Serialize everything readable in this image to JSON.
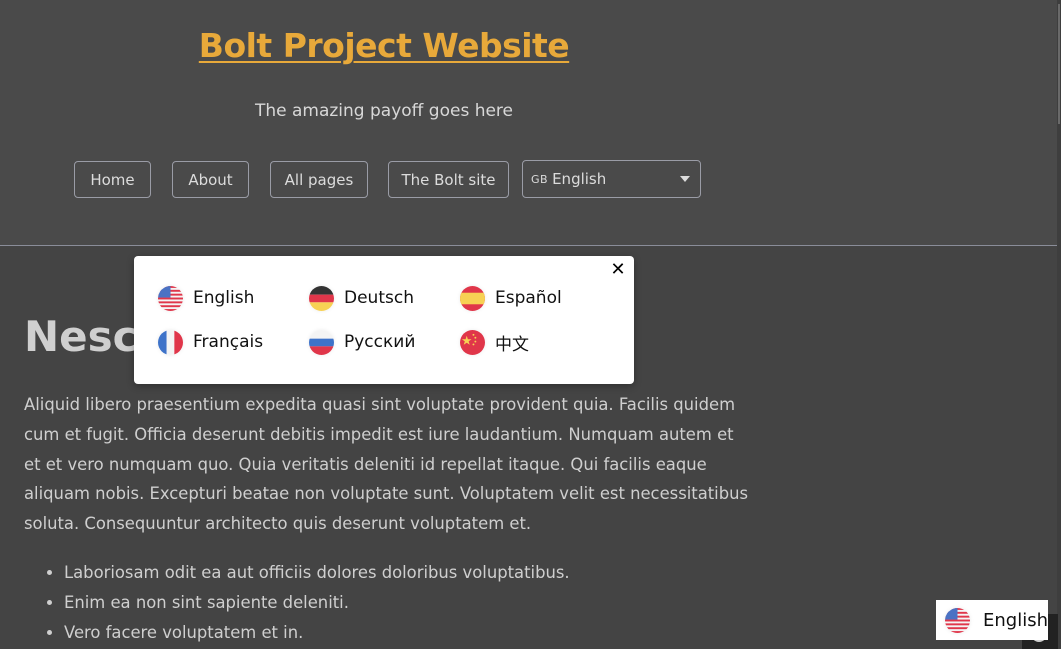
{
  "header": {
    "site_title": "Bolt Project Website",
    "payoff": "The amazing payoff goes here",
    "nav": [
      {
        "label": "Home"
      },
      {
        "label": "About"
      },
      {
        "label": "All pages"
      },
      {
        "label": "The Bolt site"
      }
    ],
    "language_select": {
      "flag_code": "GB",
      "selected": "English"
    }
  },
  "content": {
    "heading": "Nescii",
    "paragraph": "Aliquid libero praesentium expedita quasi sint voluptate provident quia. Facilis quidem cum et fugit. Officia deserunt debitis impedit est iure laudantium. Numquam autem et et et vero numquam quo. Quia veritatis deleniti id repellat itaque. Qui facilis eaque aliquam nobis. Excepturi beatae non voluptate sunt. Voluptatem velit est necessitatibus soluta. Consequuntur architecto quis deserunt voluptatem et.",
    "list": [
      "Laboriosam odit ea aut officiis dolores doloribus voluptatibus.",
      "Enim ea non sint sapiente deleniti.",
      "Vero facere voluptatem et in."
    ]
  },
  "language_modal": {
    "close_icon": "close-icon",
    "options": [
      {
        "label": "English",
        "flag": "us-flag-icon"
      },
      {
        "label": "Deutsch",
        "flag": "de-flag-icon"
      },
      {
        "label": "Español",
        "flag": "es-flag-icon"
      },
      {
        "label": "Français",
        "flag": "fr-flag-icon"
      },
      {
        "label": "Русский",
        "flag": "ru-flag-icon"
      },
      {
        "label": "中文",
        "flag": "cn-flag-icon"
      }
    ]
  },
  "floating_language": {
    "label": "English",
    "flag": "us-flag-icon"
  },
  "colors": {
    "accent": "#e8a93a",
    "header_bg": "#4a4a4a",
    "body_bg": "#444444"
  }
}
